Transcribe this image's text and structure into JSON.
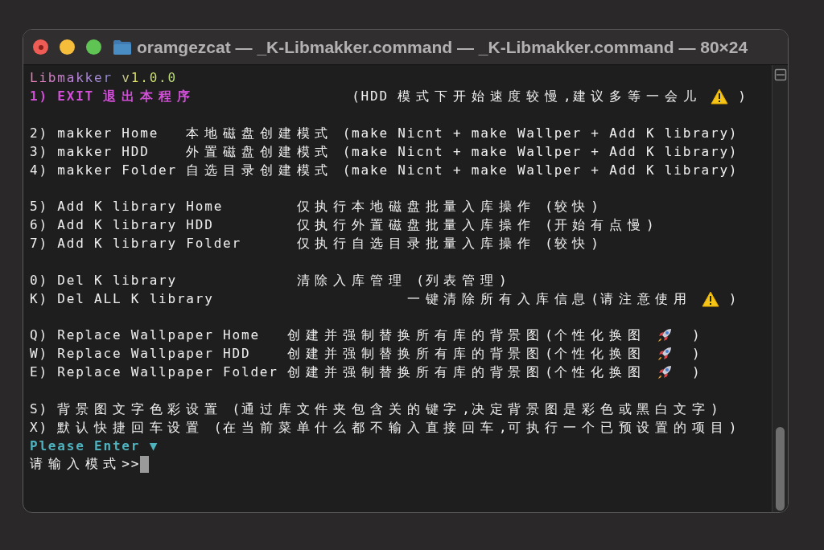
{
  "window": {
    "title": "oramgezcat — _K-Libmakker.command — _K-Libmakker.command — 80×24"
  },
  "terminal": {
    "blocks": [
      [
        [
          {
            "kind": "rainbow",
            "text": "Libmakker v1.0.0"
          }
        ],
        [
          {
            "kind": "accent",
            "text": "1) EXIT 退出本程序"
          },
          {
            "kind": "text",
            "text": "                 (HDD 模式下开始速度较慢,建议多等一会儿 "
          },
          {
            "kind": "warning-icon"
          },
          {
            "kind": "text",
            "text": " )"
          }
        ]
      ],
      [
        [
          {
            "kind": "text",
            "text": "2) makker Home   本地磁盘创建模式 (make Nicnt + make Wallper + Add K library)"
          }
        ],
        [
          {
            "kind": "text",
            "text": "3) makker HDD    外置磁盘创建模式 (make Nicnt + make Wallper + Add K library)"
          }
        ],
        [
          {
            "kind": "text",
            "text": "4) makker Folder 自选目录创建模式 (make Nicnt + make Wallper + Add K library)"
          }
        ]
      ],
      [
        [
          {
            "kind": "text",
            "text": "5) Add K library Home        仅执行本地磁盘批量入库操作 (较快)"
          }
        ],
        [
          {
            "kind": "text",
            "text": "6) Add K library HDD         仅执行外置磁盘批量入库操作 (开始有点慢)"
          }
        ],
        [
          {
            "kind": "text",
            "text": "7) Add K library Folder      仅执行自选目录批量入库操作 (较快)"
          }
        ]
      ],
      [
        [
          {
            "kind": "text",
            "text": "0) Del K library             清除入库管理 (列表管理)"
          }
        ],
        [
          {
            "kind": "text",
            "text": "K) Del ALL K library"
          },
          {
            "kind": "text",
            "text": "                     一键清除所有入库信息(请注意使用 "
          },
          {
            "kind": "warning-icon"
          },
          {
            "kind": "text",
            "text": " )"
          }
        ]
      ],
      [
        [
          {
            "kind": "text",
            "text": "Q) Replace Wallpaper Home   创建并强制替换所有库的背景图(个性化换图 "
          },
          {
            "kind": "rocket-icon"
          },
          {
            "kind": "text",
            "text": "  )"
          }
        ],
        [
          {
            "kind": "text",
            "text": "W) Replace Wallpaper HDD    创建并强制替换所有库的背景图(个性化换图 "
          },
          {
            "kind": "rocket-icon"
          },
          {
            "kind": "text",
            "text": "  )"
          }
        ],
        [
          {
            "kind": "text",
            "text": "E) Replace Wallpaper Folder 创建并强制替换所有库的背景图(个性化换图 "
          },
          {
            "kind": "rocket-icon"
          },
          {
            "kind": "text",
            "text": "  )"
          }
        ]
      ],
      [
        [
          {
            "kind": "text",
            "text": "S) 背景图文字色彩设置 (通过库文件夹包含关的键字,决定背景图是彩色或黑白文字)"
          }
        ],
        [
          {
            "kind": "text",
            "text": "X) 默认快捷回车设置 (在当前菜单什么都不输入直接回车,可执行一个已预设置的项目)"
          }
        ],
        [
          {
            "kind": "prompt",
            "text": "Please Enter ▼"
          }
        ],
        [
          {
            "kind": "text",
            "text": "请输入模式>>"
          },
          {
            "kind": "cursor"
          }
        ]
      ]
    ]
  }
}
